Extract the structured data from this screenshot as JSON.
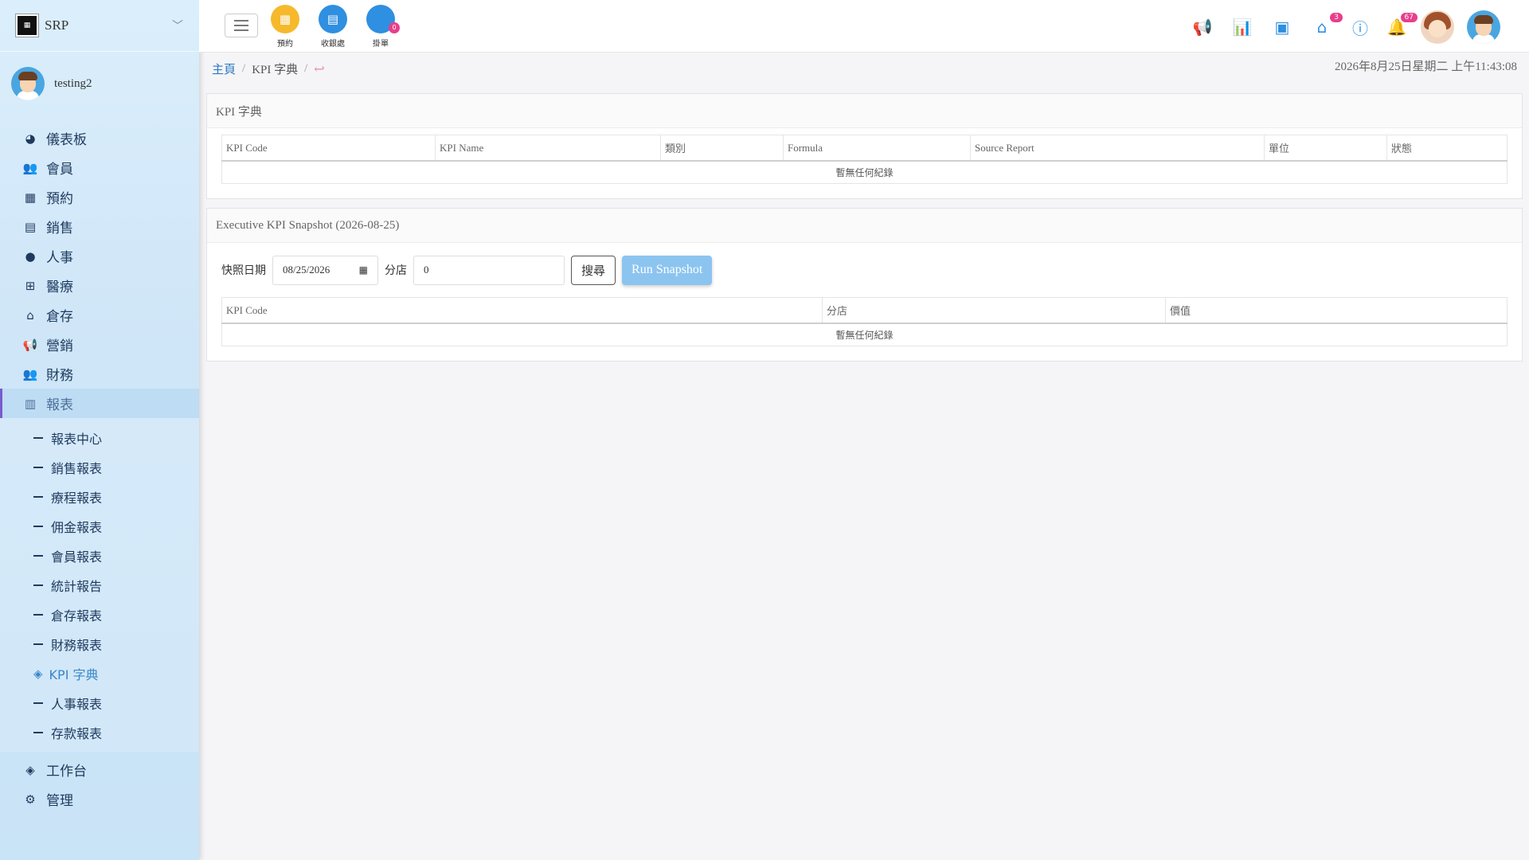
{
  "sidebar": {
    "brand": "SRP",
    "user": "testing2",
    "items": [
      {
        "label": "儀表板",
        "icon": "pie-chart-icon"
      },
      {
        "label": "會員",
        "icon": "users-icon"
      },
      {
        "label": "預約",
        "icon": "calendar-icon"
      },
      {
        "label": "銷售",
        "icon": "id-card-icon"
      },
      {
        "label": "人事",
        "icon": "user-icon"
      },
      {
        "label": "醫療",
        "icon": "medical-icon"
      },
      {
        "label": "倉存",
        "icon": "warehouse-icon"
      },
      {
        "label": "營銷",
        "icon": "megaphone-icon"
      },
      {
        "label": "財務",
        "icon": "users-icon"
      },
      {
        "label": "報表",
        "icon": "bar-chart-icon"
      }
    ],
    "sub_items": [
      "報表中心",
      "銷售報表",
      "療程報表",
      "佣金報表",
      "會員報表",
      "統計報告",
      "倉存報表",
      "財務報表",
      "KPI 字典",
      "人事報表",
      "存款報表"
    ],
    "bottom_items": [
      {
        "label": "工作台",
        "icon": "layers-icon"
      },
      {
        "label": "管理",
        "icon": "gear-icon"
      }
    ]
  },
  "header": {
    "quick": [
      {
        "label": "預約",
        "color": "#f6b92b"
      },
      {
        "label": "收銀處",
        "color": "#2f8fe0"
      },
      {
        "label": "掛單",
        "color": "#2f8fe0",
        "badge": "0"
      }
    ],
    "cake_badge": "3",
    "bell_badge": "67"
  },
  "breadcrumb": {
    "home": "主頁",
    "current": "KPI 字典"
  },
  "datetime": "2026年8月25日星期二 上午11:43:08",
  "dictionary": {
    "title": "KPI 字典",
    "columns": [
      "KPI Code",
      "KPI Name",
      "類別",
      "Formula",
      "Source Report",
      "單位",
      "狀態"
    ],
    "empty": "暫無任何紀錄"
  },
  "snapshot": {
    "title": "Executive KPI Snapshot (2026-08-25)",
    "date_label": "快照日期",
    "date_value": "08/25/2026",
    "branch_label": "分店",
    "branch_value": "0",
    "search_label": "搜尋",
    "run_label": "Run Snapshot",
    "columns": [
      "KPI Code",
      "分店",
      "價值"
    ],
    "empty": "暫無任何紀錄"
  }
}
